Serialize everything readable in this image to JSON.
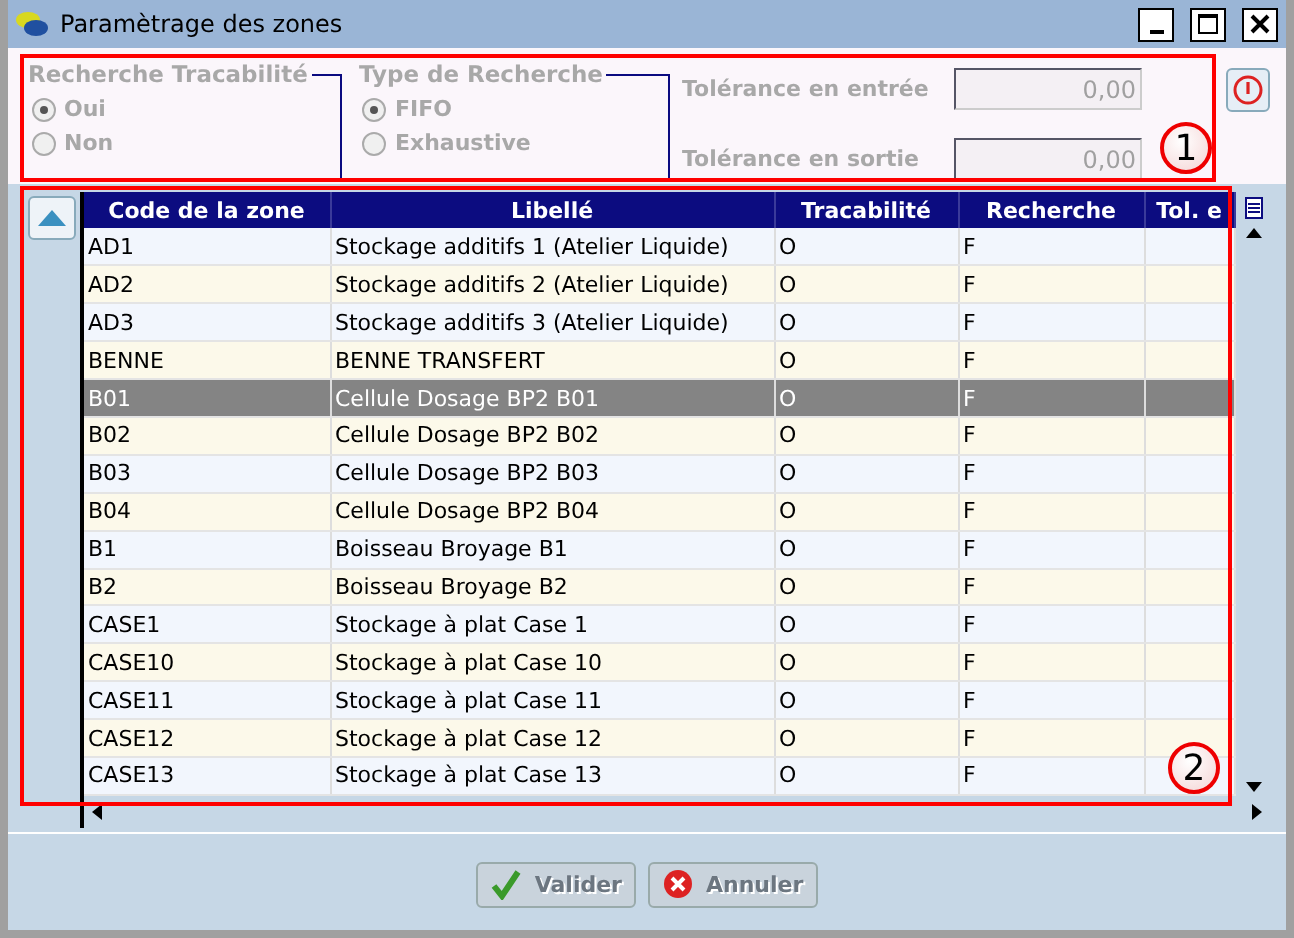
{
  "window": {
    "title": "Paramètrage des zones"
  },
  "groups": [
    {
      "title": "Recherche Tracabilité",
      "options": [
        {
          "label": "Oui",
          "selected": true
        },
        {
          "label": "Non",
          "selected": false
        }
      ]
    },
    {
      "title": "Type de Recherche",
      "options": [
        {
          "label": "FIFO",
          "selected": true
        },
        {
          "label": "Exhaustive",
          "selected": false
        }
      ]
    }
  ],
  "tolerances": [
    {
      "label": "Tolérance en entrée",
      "value": "0,00"
    },
    {
      "label": "Tolérance en sortie",
      "value": "0,00"
    }
  ],
  "table": {
    "columns": [
      "Code de la zone",
      "Libellé",
      "Tracabilité",
      "Recherche",
      "Tol. e"
    ],
    "rows": [
      {
        "cells": [
          "AD1",
          "Stockage additifs 1 (Atelier Liquide)",
          "O",
          "F",
          ""
        ],
        "selected": false
      },
      {
        "cells": [
          "AD2",
          "Stockage additifs 2 (Atelier Liquide)",
          "O",
          "F",
          ""
        ],
        "selected": false
      },
      {
        "cells": [
          "AD3",
          "Stockage additifs 3 (Atelier Liquide)",
          "O",
          "F",
          ""
        ],
        "selected": false
      },
      {
        "cells": [
          "BENNE",
          "BENNE TRANSFERT",
          "O",
          "F",
          ""
        ],
        "selected": false
      },
      {
        "cells": [
          "B01",
          "Cellule Dosage BP2 B01",
          "O",
          "F",
          ""
        ],
        "selected": true
      },
      {
        "cells": [
          "B02",
          "Cellule Dosage BP2 B02",
          "O",
          "F",
          ""
        ],
        "selected": false
      },
      {
        "cells": [
          "B03",
          "Cellule Dosage BP2 B03",
          "O",
          "F",
          ""
        ],
        "selected": false
      },
      {
        "cells": [
          "B04",
          "Cellule Dosage BP2 B04",
          "O",
          "F",
          ""
        ],
        "selected": false
      },
      {
        "cells": [
          "B1",
          "Boisseau Broyage B1",
          "O",
          "F",
          ""
        ],
        "selected": false
      },
      {
        "cells": [
          "B2",
          "Boisseau Broyage B2",
          "O",
          "F",
          ""
        ],
        "selected": false
      },
      {
        "cells": [
          "CASE1",
          "Stockage à plat Case 1",
          "O",
          "F",
          ""
        ],
        "selected": false
      },
      {
        "cells": [
          "CASE10",
          "Stockage à plat Case 10",
          "O",
          "F",
          ""
        ],
        "selected": false
      },
      {
        "cells": [
          "CASE11",
          "Stockage à plat Case 11",
          "O",
          "F",
          ""
        ],
        "selected": false
      },
      {
        "cells": [
          "CASE12",
          "Stockage à plat Case 12",
          "O",
          "F",
          ""
        ],
        "selected": false
      },
      {
        "cells": [
          "CASE13",
          "Stockage à plat Case 13",
          "O",
          "F",
          ""
        ],
        "selected": false
      }
    ]
  },
  "buttons": [
    {
      "label": "Valider",
      "kind": "ok",
      "disabled": true
    },
    {
      "label": "Annuler",
      "kind": "cancel",
      "disabled": true
    }
  ],
  "annotations": [
    "1",
    "2"
  ]
}
